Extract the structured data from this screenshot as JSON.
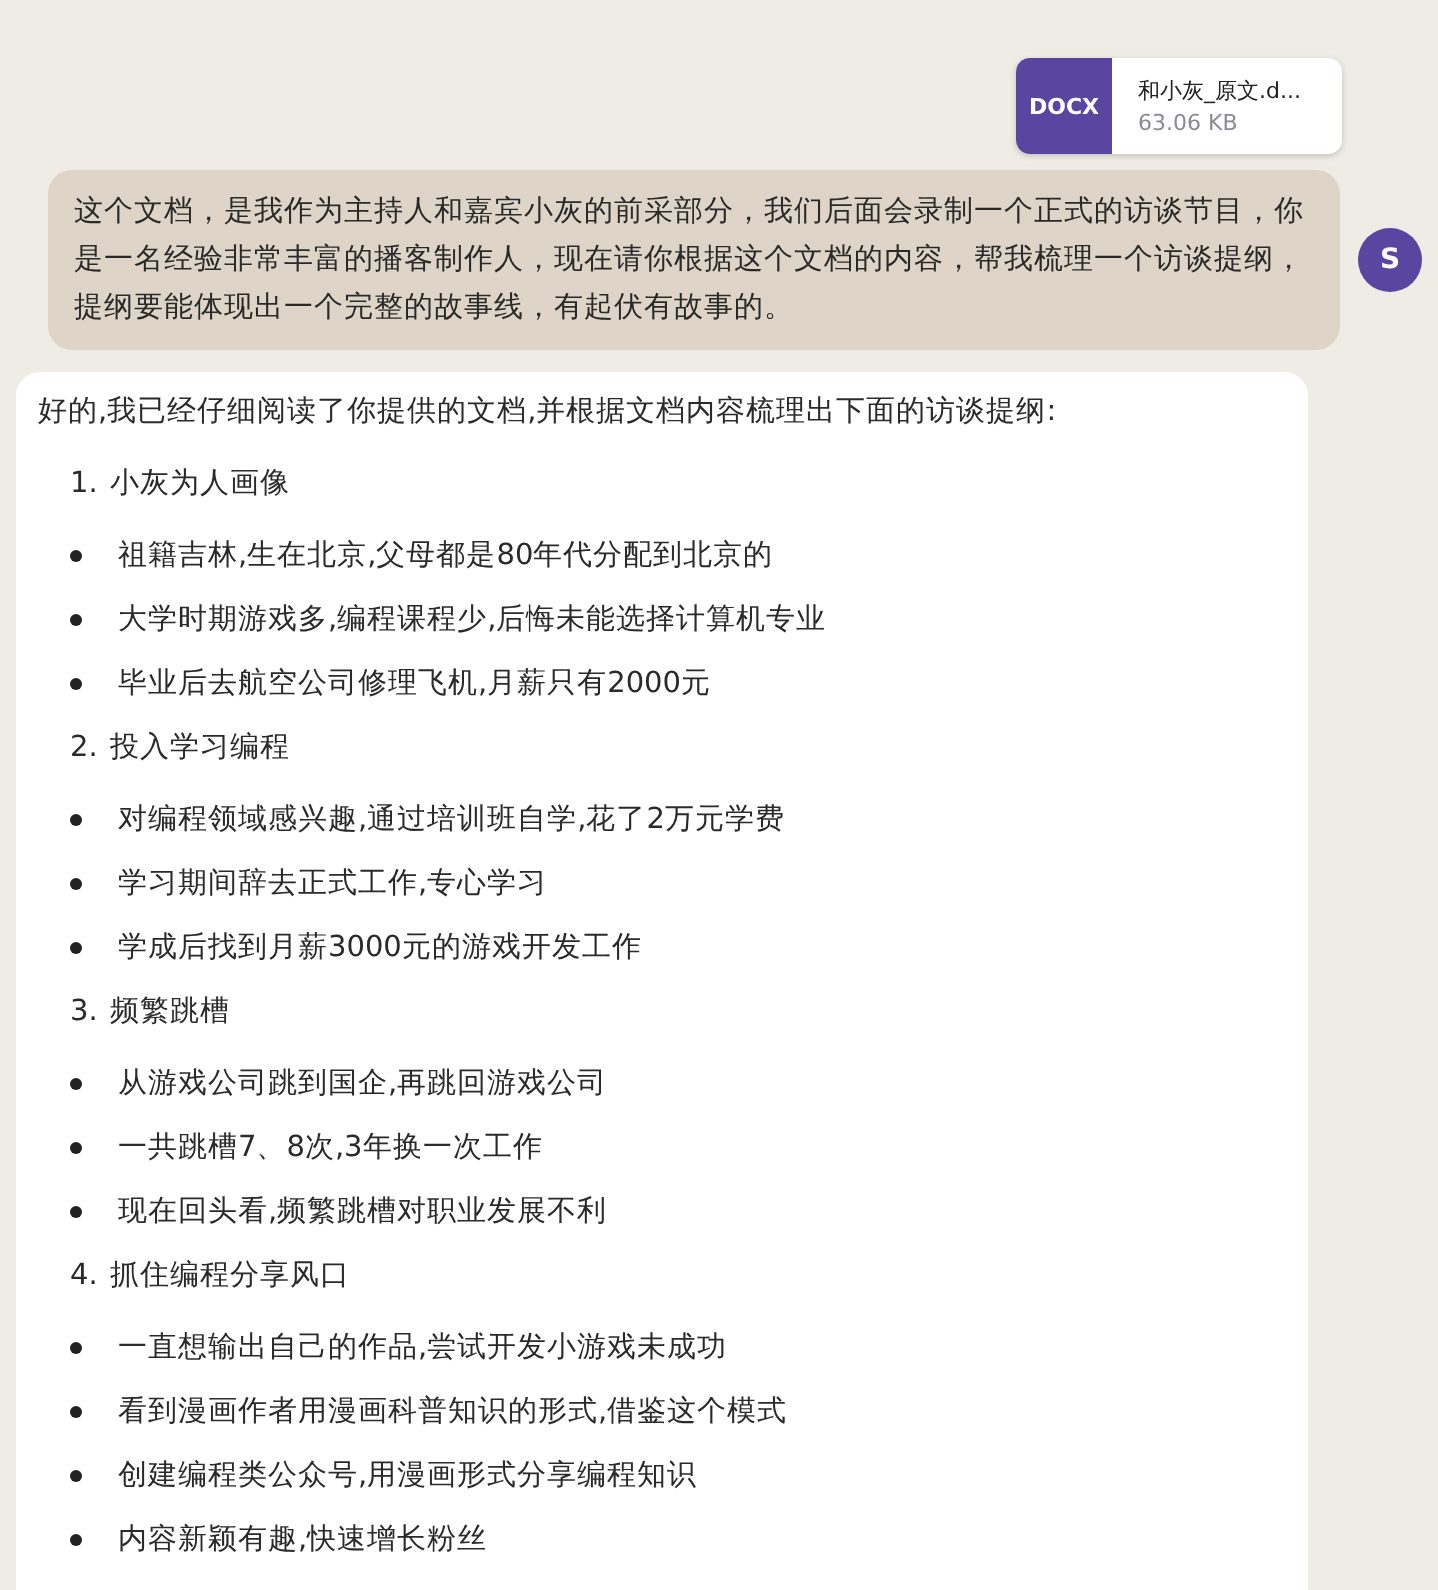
{
  "attachment": {
    "type": "DOCX",
    "name": "和小灰_原文.d...",
    "size": "63.06 KB"
  },
  "user_message": {
    "text": "这个文档，是我作为主持人和嘉宾小灰的前采部分，我们后面会录制一个正式的访谈节目，你是一名经验非常丰富的播客制作人，现在请你根据这个文档的内容，帮我梳理一个访谈提纲，提纲要能体现出一个完整的故事线，有起伏有故事的。",
    "avatar": "S"
  },
  "reply": {
    "intro": "好的,我已经仔细阅读了你提供的文档,并根据文档内容梳理出下面的访谈提纲:",
    "sections": [
      {
        "number": "1.",
        "title": "小灰为人画像",
        "children": [
          {
            "text": "祖籍吉林,生在北京,父母都是80年代分配到北京的"
          },
          {
            "text": "大学时期游戏多,编程课程少,后悔未能选择计算机专业"
          },
          {
            "text": "毕业后去航空公司修理飞机,月薪只有2000元"
          }
        ]
      },
      {
        "number": "2.",
        "title": "投入学习编程",
        "children": [
          {
            "text": "对编程领域感兴趣,通过培训班自学,花了2万元学费"
          },
          {
            "text": "学习期间辞去正式工作,专心学习"
          },
          {
            "text": "学成后找到月薪3000元的游戏开发工作"
          }
        ]
      },
      {
        "number": "3.",
        "title": "频繁跳槽",
        "children": [
          {
            "text": "从游戏公司跳到国企,再跳回游戏公司"
          },
          {
            "text": "一共跳槽7、8次,3年换一次工作"
          },
          {
            "text": "现在回头看,频繁跳槽对职业发展不利"
          }
        ]
      },
      {
        "number": "4.",
        "title": "抓住编程分享风口",
        "children": [
          {
            "text": "一直想输出自己的作品,尝试开发小游戏未成功"
          },
          {
            "text": "看到漫画作者用漫画科普知识的形式,借鉴这个模式"
          },
          {
            "text": "创建编程类公众号,用漫画形式分享编程知识"
          },
          {
            "text": "内容新颖有趣,快速增长粉丝"
          }
        ]
      }
    ]
  }
}
